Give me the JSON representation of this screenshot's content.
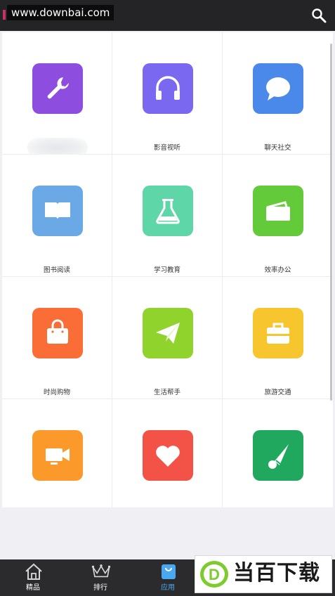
{
  "header": {
    "watermark_url": "www.downbai.com",
    "search_icon": "search-icon",
    "background": "#242325"
  },
  "categories": [
    {
      "label": "",
      "icon": "wrench-icon",
      "color": "#8d4ee0",
      "label_blurred": true
    },
    {
      "label": "影音视听",
      "icon": "headphones-icon",
      "color": "#7a69f0"
    },
    {
      "label": "聊天社交",
      "icon": "chat-bubble-icon",
      "color": "#4a88ea"
    },
    {
      "label": "图书阅读",
      "icon": "open-book-icon",
      "color": "#6aa9e6"
    },
    {
      "label": "学习教育",
      "icon": "flask-icon",
      "color": "#5fd6a8"
    },
    {
      "label": "效率办公",
      "icon": "folder-icon",
      "color": "#63cb3a"
    },
    {
      "label": "时尚购物",
      "icon": "shopping-bag-icon",
      "color": "#fb6d36"
    },
    {
      "label": "生活帮手",
      "icon": "paper-plane-icon",
      "color": "#8fd32c"
    },
    {
      "label": "旅游交通",
      "icon": "suitcase-icon",
      "color": "#f7c62e"
    },
    {
      "label": "",
      "icon": "video-camera-icon",
      "color": "#fb9a2a"
    },
    {
      "label": "",
      "icon": "heart-icon",
      "color": "#f35346"
    },
    {
      "label": "",
      "icon": "badminton-shuttlecock-icon",
      "color": "#1fa85e"
    }
  ],
  "bottom_nav": {
    "items": [
      {
        "label": "精品",
        "icon": "home-icon",
        "active": false
      },
      {
        "label": "排行",
        "icon": "crown-icon",
        "active": false
      },
      {
        "label": "应用",
        "icon": "bag-icon",
        "active": true
      }
    ],
    "active_color": "#4aa8f0"
  },
  "brand_watermark": {
    "letter": "D",
    "text": "当百下载",
    "color": "#7ecb2f"
  }
}
